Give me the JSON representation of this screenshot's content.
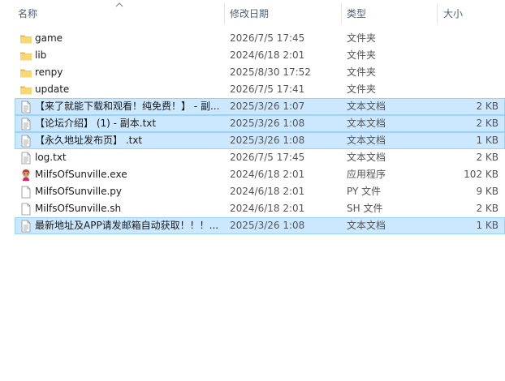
{
  "columns": {
    "name": "名称",
    "date": "修改日期",
    "type": "类型",
    "size": "大小"
  },
  "colors": {
    "selection_bg": "#cce8ff",
    "selection_border": "#99d1ff",
    "header_text": "#4c607a",
    "folder_yellow": "#f8d775"
  },
  "files": [
    {
      "name": "game",
      "date": "2026/7/5 17:45",
      "type": "文件夹",
      "size": "",
      "icon": "folder-icon",
      "selected": false
    },
    {
      "name": "lib",
      "date": "2024/6/18 2:01",
      "type": "文件夹",
      "size": "",
      "icon": "folder-icon",
      "selected": false
    },
    {
      "name": "renpy",
      "date": "2025/8/30 17:52",
      "type": "文件夹",
      "size": "",
      "icon": "folder-icon",
      "selected": false
    },
    {
      "name": "update",
      "date": "2026/7/5 17:41",
      "type": "文件夹",
      "size": "",
      "icon": "folder-icon",
      "selected": false
    },
    {
      "name": "【来了就能下载和观看！纯免费！】 - 副...",
      "date": "2025/3/26 1:07",
      "type": "文本文档",
      "size": "2 KB",
      "icon": "text-file-icon",
      "selected": true
    },
    {
      "name": "【论坛介绍】 (1) - 副本.txt",
      "date": "2025/3/26 1:08",
      "type": "文本文档",
      "size": "2 KB",
      "icon": "text-file-icon",
      "selected": true
    },
    {
      "name": "【永久地址发布页】 .txt",
      "date": "2025/3/26 1:08",
      "type": "文本文档",
      "size": "1 KB",
      "icon": "text-file-icon",
      "selected": true
    },
    {
      "name": "log.txt",
      "date": "2026/7/5 17:45",
      "type": "文本文档",
      "size": "2 KB",
      "icon": "text-file-icon",
      "selected": false
    },
    {
      "name": "MilfsOfSunville.exe",
      "date": "2024/6/18 2:01",
      "type": "应用程序",
      "size": "102 KB",
      "icon": "exe-app-icon",
      "selected": false
    },
    {
      "name": "MilfsOfSunville.py",
      "date": "2024/6/18 2:01",
      "type": "PY 文件",
      "size": "9 KB",
      "icon": "blank-file-icon",
      "selected": false
    },
    {
      "name": "MilfsOfSunville.sh",
      "date": "2024/6/18 2:01",
      "type": "SH 文件",
      "size": "2 KB",
      "icon": "blank-file-icon",
      "selected": false
    },
    {
      "name": "最新地址及APP请发邮箱自动获取！！！...",
      "date": "2025/3/26 1:08",
      "type": "文本文档",
      "size": "1 KB",
      "icon": "text-file-icon",
      "selected": true
    }
  ]
}
